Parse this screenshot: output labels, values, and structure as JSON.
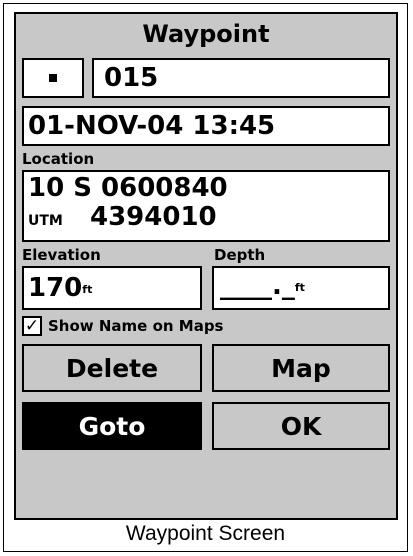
{
  "screen": {
    "title": "Waypoint",
    "symbol_icon": "square-dot-icon",
    "waypoint_name": "015",
    "datetime": "01-NOV-04 13:45",
    "location_label": "Location",
    "location_line1": "10 S 0600840",
    "utm_label": "UTM",
    "location_line2": "4394010",
    "elevation_label": "Elevation",
    "elevation_value": "170",
    "elevation_unit": "ft",
    "depth_label": "Depth",
    "depth_value": "____._",
    "depth_unit": "ft",
    "show_name_checked": true,
    "show_name_label": "Show Name on Maps",
    "buttons": {
      "delete": "Delete",
      "map": "Map",
      "goto": "Goto",
      "ok": "OK"
    }
  },
  "caption": "Waypoint Screen"
}
